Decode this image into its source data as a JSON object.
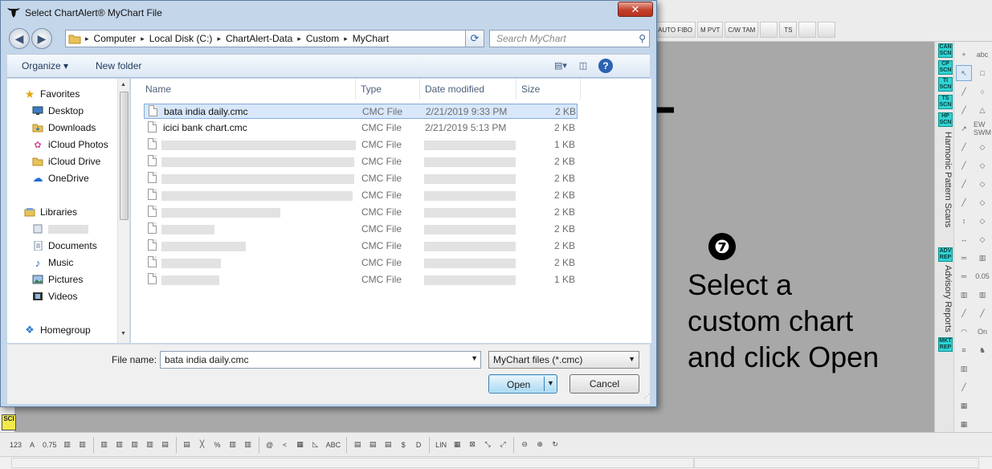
{
  "app": {
    "top_toolbar": [
      "AUTO FIBO",
      "M PVT",
      "C/W TAM",
      "",
      "TS",
      "",
      ""
    ],
    "left_badge": "SCI",
    "right_rail": {
      "scan_buttons": [
        "CAN SCN",
        "CP SCN",
        "TI SCN",
        "TS SCN",
        "HP SCN"
      ],
      "scan_label": "Harmonic Pattern Scans",
      "report_buttons": [
        "ADV REP"
      ],
      "report_label": "Advisory Reports",
      "market_button": "MKT REP"
    },
    "draw_tools_left": [
      "+",
      "↖",
      "╱",
      "╱",
      "↗",
      "╱",
      "╱",
      "╱",
      "╱",
      "↕",
      "↔",
      "═",
      "═",
      "▥",
      "╱",
      "◠",
      "≡",
      "▥",
      "╱",
      "▦",
      "▦",
      "▦",
      "▦"
    ],
    "draw_tools_right": [
      "abc",
      "□",
      "○",
      "△",
      "EW SWM",
      "◇",
      "◇",
      "◇",
      "◇",
      "◇",
      "◇",
      "▥",
      "0.05",
      "▥",
      "╱",
      "On",
      "♞"
    ],
    "bottom_tools": [
      "123",
      "A",
      "0.75",
      "▥",
      "▥",
      "▥",
      "▥",
      "▥",
      "▥",
      "▤",
      "▤",
      "╳",
      "%",
      "▥",
      "▥",
      "@",
      "<",
      "▦",
      "◺",
      "ABC",
      "▤",
      "▤",
      "▤",
      "$",
      "D",
      "LIN",
      "▦",
      "⊠",
      "⤡",
      "⤢",
      "⊖",
      "⊕",
      "↻"
    ]
  },
  "dialog": {
    "title": "Select ChartAlert® MyChart File",
    "close_label": "✕",
    "breadcrumbs": [
      "Computer",
      "Local Disk (C:)",
      "ChartAlert-Data",
      "Custom",
      "MyChart"
    ],
    "search_placeholder": "Search MyChart",
    "organize_label": "Organize ▾",
    "new_folder_label": "New folder",
    "nav": {
      "favorites_header": "Favorites",
      "favorites": [
        "Desktop",
        "Downloads",
        "iCloud Photos",
        "iCloud Drive",
        "OneDrive"
      ],
      "libraries_header": "Libraries",
      "libraries": [
        "Documents",
        "Music",
        "Pictures",
        "Videos"
      ],
      "homegroup": "Homegroup"
    },
    "columns": [
      "Name",
      "Type",
      "Date modified",
      "Size"
    ],
    "files": [
      {
        "name": "bata india daily.cmc",
        "type": "CMC File",
        "date": "2/21/2019 9:33 PM",
        "size": "2 KB",
        "selected": true
      },
      {
        "name": "icici bank chart.cmc",
        "type": "CMC File",
        "date": "2/21/2019 5:13 PM",
        "size": "2 KB"
      },
      {
        "name": "",
        "type": "CMC File",
        "date": "",
        "size": "1 KB"
      },
      {
        "name": "",
        "type": "CMC File",
        "date": "",
        "size": "2 KB"
      },
      {
        "name": "",
        "type": "CMC File",
        "date": "",
        "size": "2 KB"
      },
      {
        "name": "",
        "type": "CMC File",
        "date": "",
        "size": "2 KB"
      },
      {
        "name": "",
        "type": "CMC File",
        "date": "",
        "size": "2 KB"
      },
      {
        "name": "",
        "type": "CMC File",
        "date": "",
        "size": "2 KB"
      },
      {
        "name": "",
        "type": "CMC File",
        "date": "",
        "size": "2 KB"
      },
      {
        "name": "",
        "type": "CMC File",
        "date": "",
        "size": "2 KB"
      },
      {
        "name": "",
        "type": "CMC File",
        "date": "",
        "size": "1 KB"
      }
    ],
    "file_name_label": "File name:",
    "file_name_value": "bata india daily.cmc",
    "filter_value": "MyChart files (*.cmc)",
    "open_label": "Open",
    "cancel_label": "Cancel"
  },
  "callout": {
    "step": "❼",
    "text_lines": [
      "Select a",
      "custom chart",
      "and click Open"
    ]
  },
  "colors": {
    "canvas": "#a8a8a8",
    "scan_accent": "#2fd3d3",
    "selection": "#d8e7fa",
    "close_red": "#c2402d"
  }
}
